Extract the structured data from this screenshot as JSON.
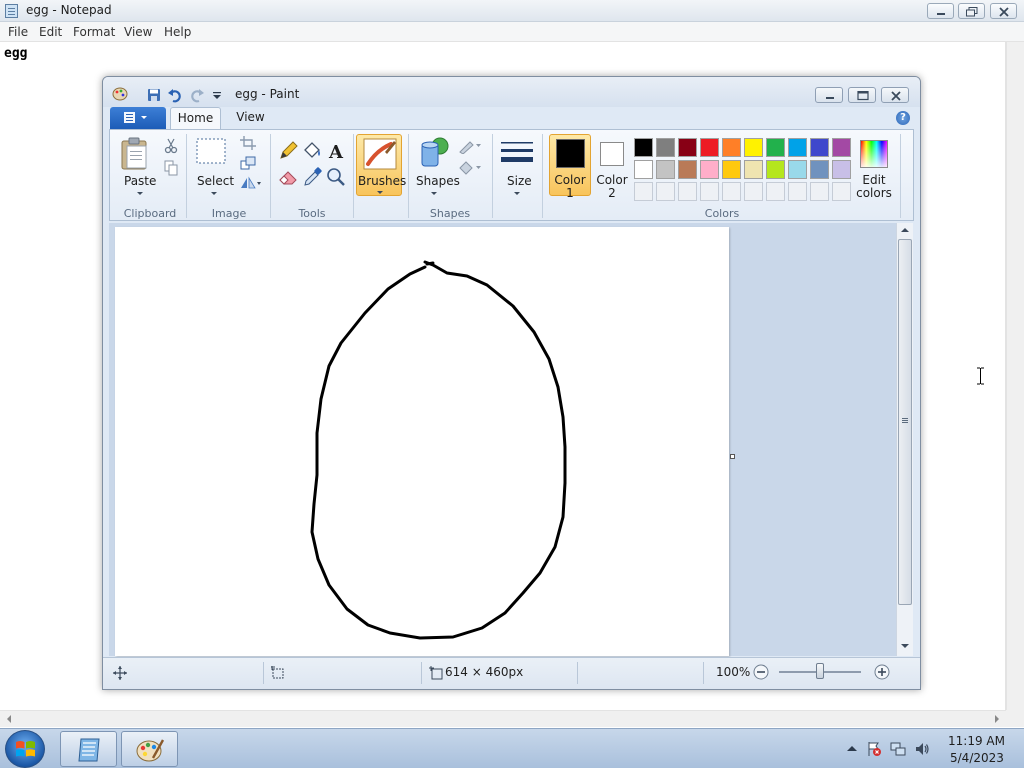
{
  "notepad": {
    "title": "egg - Notepad",
    "menu": [
      "File",
      "Edit",
      "Format",
      "View",
      "Help"
    ],
    "content": "egg"
  },
  "paint": {
    "title": "egg - Paint",
    "tabs": [
      "Home",
      "View"
    ],
    "groups": {
      "clipboard": "Clipboard",
      "image": "Image",
      "tools": "Tools",
      "shapes": "Shapes",
      "colors": "Colors"
    },
    "buttons": {
      "paste": "Paste",
      "select": "Select",
      "brushes": "Brushes",
      "shapes": "Shapes",
      "size": "Size",
      "color1_line1": "Color",
      "color1_line2": "1",
      "color2_line1": "Color",
      "color2_line2": "2",
      "edit_colors_line1": "Edit",
      "edit_colors_line2": "colors"
    },
    "palette_row1": [
      "#000000",
      "#7f7f7f",
      "#880015",
      "#ed1c24",
      "#ff7f27",
      "#fff200",
      "#22b14c",
      "#00a2e8",
      "#3f48cc",
      "#a349a4"
    ],
    "palette_row2": [
      "#ffffff",
      "#c3c3c3",
      "#b97a57",
      "#ffaec9",
      "#ffc90e",
      "#efe4b0",
      "#b5e61d",
      "#99d9ea",
      "#7092be",
      "#c8bfe7"
    ],
    "color1": "#000000",
    "color2": "#ffffff",
    "status": {
      "canvas_size": "614 × 460px",
      "zoom": "100%"
    }
  },
  "taskbar": {
    "time": "11:19 AM",
    "date": "5/4/2023"
  }
}
